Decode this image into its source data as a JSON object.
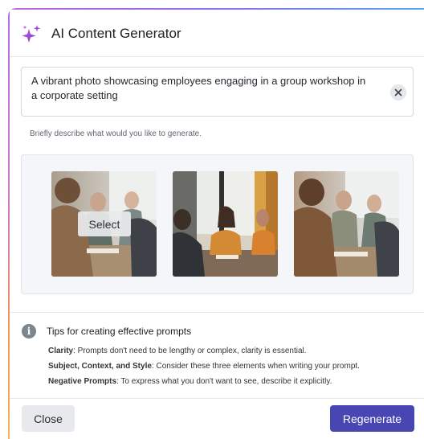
{
  "dialog": {
    "title": "AI Content Generator",
    "title_icon": "sparkle-icon",
    "accent_color": "#4746b2"
  },
  "prompt": {
    "value": "A vibrant photo showcasing employees engaging in a group workshop in a corporate setting",
    "clear_icon": "close-icon",
    "hint": "Briefly describe what would you like to generate."
  },
  "images": {
    "select_label": "Select",
    "items": [
      {
        "name": "generated-image-1",
        "hovered": true
      },
      {
        "name": "generated-image-2",
        "hovered": false
      },
      {
        "name": "generated-image-3",
        "hovered": false
      }
    ]
  },
  "tips": {
    "icon": "info-icon",
    "title": "Tips for creating effective prompts",
    "items": [
      {
        "label": "Clarity",
        "text": ": Prompts don't need to be lengthy or complex, clarity is essential."
      },
      {
        "label": "Subject, Context, and Style",
        "text": ": Consider these three elements when writing your prompt."
      },
      {
        "label": "Negative Prompts",
        "text": ": To express what you don't want to see, describe it explicitly."
      }
    ]
  },
  "footer": {
    "close_label": "Close",
    "regenerate_label": "Regenerate"
  }
}
